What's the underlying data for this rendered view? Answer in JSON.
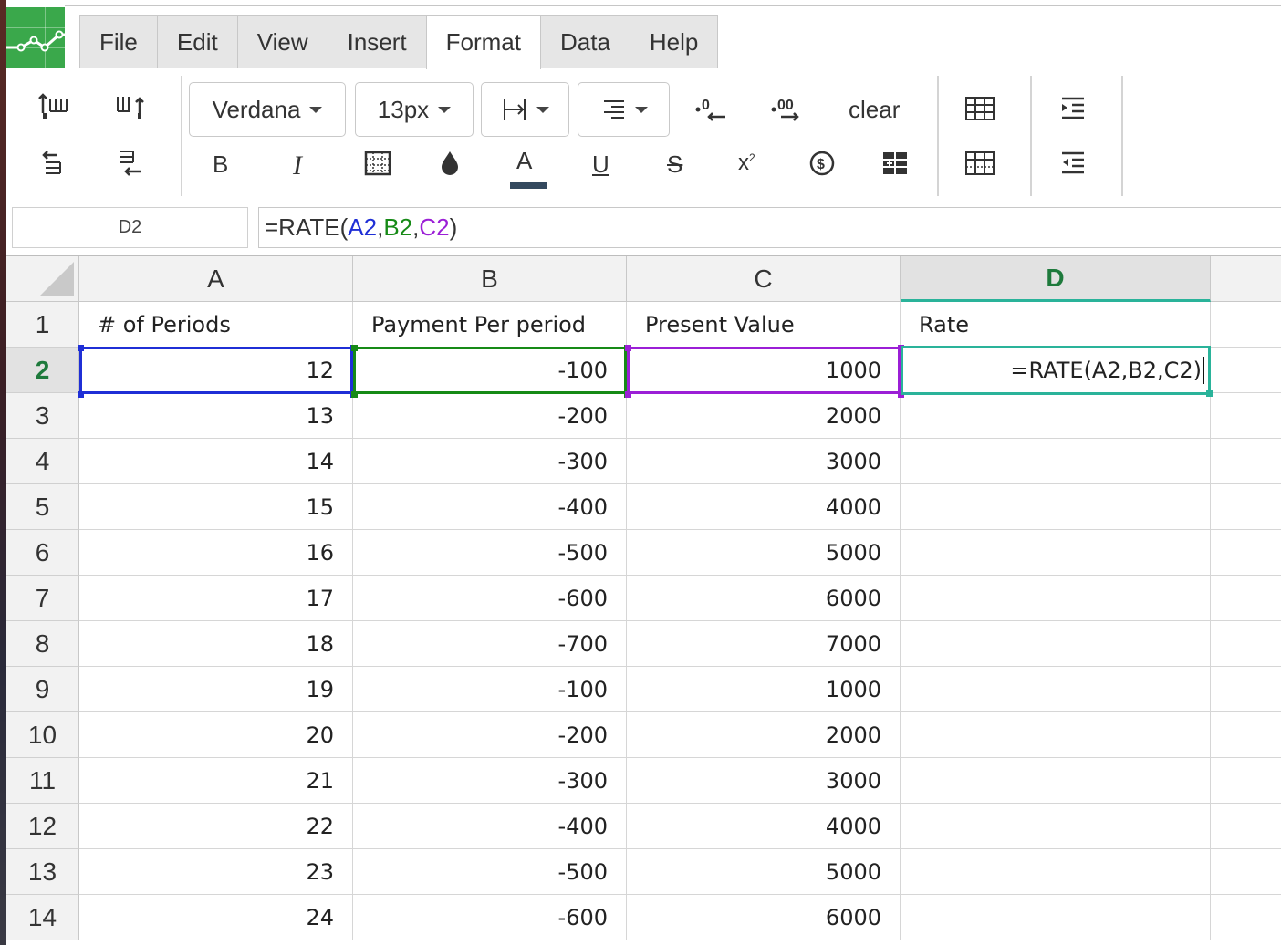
{
  "menubar": {
    "items": [
      {
        "label": "File",
        "active": false
      },
      {
        "label": "Edit",
        "active": false
      },
      {
        "label": "View",
        "active": false
      },
      {
        "label": "Insert",
        "active": false
      },
      {
        "label": "Format",
        "active": true
      },
      {
        "label": "Data",
        "active": false
      },
      {
        "label": "Help",
        "active": false
      }
    ]
  },
  "toolbar": {
    "font_family": "Verdana",
    "font_size": "13px",
    "clear_label": "clear",
    "bold_label": "B",
    "italic_label": "I",
    "text_color_label": "A",
    "text_color_swatch": "#34495e",
    "underline_label": "U",
    "strike_label": "S",
    "superscript_label": "x",
    "superscript_mark": "2",
    "icons": [
      "insert-row-above-icon",
      "insert-column-right-icon",
      "insert-row-below-icon",
      "insert-column-left-icon",
      "vertical-align-icon",
      "horizontal-align-icon",
      "decrease-decimal-icon",
      "increase-decimal-icon",
      "borders-icon",
      "fill-color-icon",
      "text-color-icon",
      "currency-icon",
      "merge-cells-icon",
      "table-icon",
      "table-dotted-icon",
      "indent-increase-icon",
      "indent-decrease-icon"
    ]
  },
  "formula_bar": {
    "name_box": "D2",
    "prefix": "=RATE(",
    "ref_a": "A2",
    "comma1": ",",
    "ref_b": "B2",
    "comma2": ",",
    "ref_c": "C2",
    "suffix": ")",
    "colors": {
      "a": "#1f2fd6",
      "b": "#168a16",
      "c": "#9b1fd6"
    }
  },
  "sheet": {
    "columns": [
      "A",
      "B",
      "C",
      "D"
    ],
    "selected_column": "D",
    "selected_row": "2",
    "row_numbers": [
      "1",
      "2",
      "3",
      "4",
      "5",
      "6",
      "7",
      "8",
      "9",
      "10",
      "11",
      "12",
      "13",
      "14"
    ],
    "header_row": [
      "# of Periods",
      "Payment Per period",
      "Present Value",
      "Rate"
    ],
    "rows": [
      [
        "12",
        "-100",
        "1000",
        ""
      ],
      [
        "13",
        "-200",
        "2000",
        ""
      ],
      [
        "14",
        "-300",
        "3000",
        ""
      ],
      [
        "15",
        "-400",
        "4000",
        ""
      ],
      [
        "16",
        "-500",
        "5000",
        ""
      ],
      [
        "17",
        "-600",
        "6000",
        ""
      ],
      [
        "18",
        "-700",
        "7000",
        ""
      ],
      [
        "19",
        "-100",
        "1000",
        ""
      ],
      [
        "20",
        "-200",
        "2000",
        ""
      ],
      [
        "21",
        "-300",
        "3000",
        ""
      ],
      [
        "22",
        "-400",
        "4000",
        ""
      ],
      [
        "23",
        "-500",
        "5000",
        ""
      ],
      [
        "24",
        "-600",
        "6000",
        ""
      ]
    ],
    "editor_text": "=RATE(A2,B2,C2)",
    "accent": "#2ab39a"
  }
}
